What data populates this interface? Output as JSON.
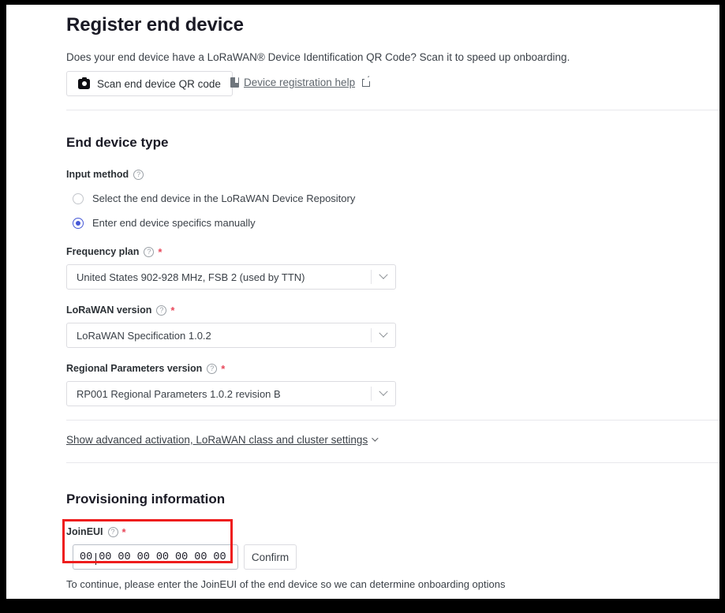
{
  "page": {
    "title": "Register end device",
    "intro": "Does your end device have a LoRaWAN® Device Identification QR Code? Scan it to speed up onboarding."
  },
  "actions": {
    "scan_button": "Scan end device QR code",
    "scan_icon": "camera-icon",
    "help_link": "Device registration help",
    "help_icon": "book-icon",
    "external_icon": "external-link-icon"
  },
  "end_device_type": {
    "heading": "End device type",
    "input_method": {
      "label": "Input method",
      "tooltip_icon": "help-circle-icon",
      "options": [
        {
          "label": "Select the end device in the LoRaWAN Device Repository",
          "selected": false
        },
        {
          "label": "Enter end device specifics manually",
          "selected": true
        }
      ]
    },
    "fields": [
      {
        "label": "Frequency plan",
        "required": "*",
        "tooltip_icon": "help-circle-icon",
        "value": "United States 902-928 MHz, FSB 2 (used by TTN)",
        "chevron_icon": "chevron-down-icon"
      },
      {
        "label": "LoRaWAN version",
        "required": "*",
        "tooltip_icon": "help-circle-icon",
        "value": "LoRaWAN Specification 1.0.2",
        "chevron_icon": "chevron-down-icon"
      },
      {
        "label": "Regional Parameters version",
        "required": "*",
        "tooltip_icon": "help-circle-icon",
        "value": "RP001 Regional Parameters 1.0.2 revision B",
        "chevron_icon": "chevron-down-icon"
      }
    ],
    "advanced_toggle": {
      "label": "Show advanced activation, LoRaWAN class and cluster settings",
      "chevron_icon": "chevron-down-icon"
    }
  },
  "provisioning": {
    "heading": "Provisioning information",
    "joineui": {
      "label": "JoinEUI",
      "required": "*",
      "tooltip_icon": "help-circle-icon",
      "pairs": [
        "00",
        "00",
        "00",
        "00",
        "00",
        "00",
        "00",
        "00"
      ],
      "confirm_button": "Confirm"
    },
    "helper_text": "To continue, please enter the JoinEUI of the end device so we can determine onboarding options"
  },
  "colors": {
    "accent": "#4658d6",
    "required": "#e8475a",
    "annotation": "#ee1d1d",
    "text": "#3b4148",
    "heading": "#1a1a25",
    "border": "#dcdce1"
  }
}
